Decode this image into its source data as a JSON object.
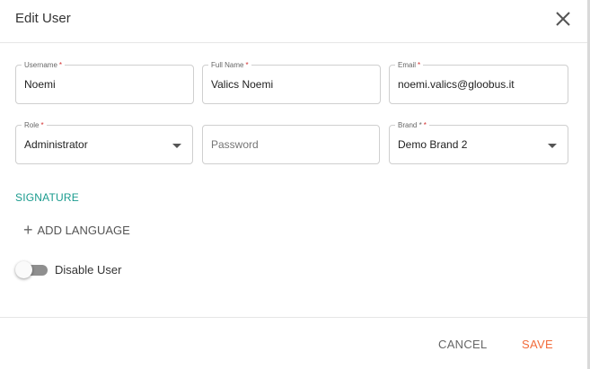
{
  "dialog": {
    "title": "Edit User"
  },
  "form": {
    "username": {
      "label": "Username",
      "required": "*",
      "value": "Noemi"
    },
    "full_name": {
      "label": "Full Name",
      "required": "*",
      "value": "Valics Noemi"
    },
    "email": {
      "label": "Email",
      "required": "*",
      "value": "noemi.valics@gloobus.it"
    },
    "role": {
      "label": "Role",
      "required": "*",
      "value": "Administrator"
    },
    "password": {
      "placeholder": "Password"
    },
    "brand": {
      "label": "Brand *",
      "required": "*",
      "value": "Demo Brand 2"
    }
  },
  "signature": {
    "section_title": "SIGNATURE",
    "add_language_label": "ADD LANGUAGE"
  },
  "disable_user": {
    "label": "Disable User",
    "enabled": false
  },
  "footer": {
    "cancel_label": "CANCEL",
    "save_label": "SAVE"
  },
  "colors": {
    "accent_teal": "#1a9b8e",
    "save_orange": "#f26b3a",
    "required_red": "#d32f2f"
  },
  "icons": {
    "close": "close-icon",
    "plus": "plus-icon",
    "dropdown": "chevron-down-icon"
  }
}
